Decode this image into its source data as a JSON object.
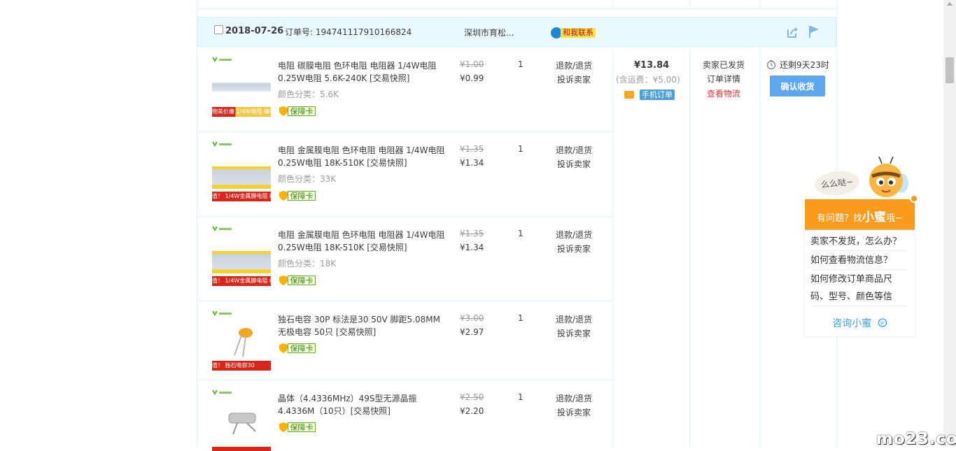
{
  "order": {
    "date": "2018-07-26",
    "order_no": "订单号: 194741117910166824",
    "shop": "深圳市育松...",
    "contact_label": "和我联系",
    "total": "¥13.84",
    "shipping_fee": "(含运费：¥5.00)",
    "mobile_order_label": "手机订单",
    "status": "卖家已发货",
    "detail_link": "订单详情",
    "logistics_link": "查看物流",
    "remaining": "还剩9天23时",
    "confirm_button": "确认收货"
  },
  "items": [
    {
      "title": "电阻 碳膜电阻 色环电阻 电阻器 1/4W电阻 0.25W电阻 5.6K-240K [交易快照]",
      "attr": "颜色分类：5.6K",
      "badge": "保障卡",
      "old_price": "¥1.00",
      "price": "¥0.99",
      "qty": "1",
      "service1": "退款/退货",
      "service2": "投诉卖家",
      "banner": "物美价廉 1/4W电阻 编带"
    },
    {
      "title": "电阻 金属膜电阻 色环电阻 电阻器 1/4W电阻 0.25W电阻 18K-510K [交易快照]",
      "attr": "颜色分类：33K",
      "badge": "保障卡",
      "old_price": "¥1.35",
      "price": "¥1.34",
      "qty": "1",
      "service1": "退款/退货",
      "service2": "投诉卖家",
      "banner": "值！ 1/4W金属膜电阻 编带1%"
    },
    {
      "title": "电阻 金属膜电阻 色环电阻 电阻器 1/4W电阻 0.25W电阻 18K-510K [交易快照]",
      "attr": "颜色分类：18K",
      "badge": "保障卡",
      "old_price": "¥1.35",
      "price": "¥1.34",
      "qty": "1",
      "service1": "退款/退货",
      "service2": "投诉卖家",
      "banner": "值！ 1/4W金属膜电阻 编带1%"
    },
    {
      "title": "独石电容 30P 标法是30 50V 脚距5.08MM 无极电容 50只 [交易快照]",
      "attr": "",
      "badge": "保障卡",
      "old_price": "¥3.00",
      "price": "¥2.97",
      "qty": "1",
      "service1": "退款/退货",
      "service2": "投诉卖家",
      "banner": "值！ 独石电容30"
    },
    {
      "title": "晶体（4.4336MHz）49S型无源晶振4.4336M（10只）[交易快照]",
      "attr": "",
      "badge": "保障卡",
      "old_price": "¥2.50",
      "price": "¥2.20",
      "qty": "1",
      "service1": "退款/退货",
      "service2": "投诉卖家",
      "banner": ""
    }
  ],
  "helper": {
    "bubble": "么么哒~",
    "head_prefix": "有问题？找",
    "head_name": "小蜜",
    "head_suffix": "哦~",
    "questions": [
      "卖家不发货，怎么办？",
      "如何查看物流信息？",
      "如何修改订单商品尺码、型号、颜色等信"
    ],
    "consult": "咨询小蜜"
  },
  "watermark": "mo23.com",
  "colors": {
    "accent_blue": "#5ea7ee",
    "link_red": "#e4393c",
    "helper_orange": "#fa9b1d"
  }
}
